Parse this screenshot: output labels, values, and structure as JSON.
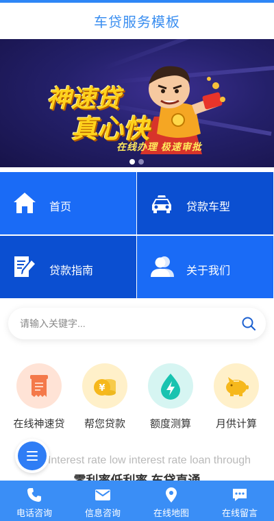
{
  "header": {
    "title": "车贷服务模板"
  },
  "banner": {
    "headline1": "神速贷",
    "headline2": "真心快",
    "slogan": "在线办理  极速审批",
    "active_slide": 1,
    "slide_count": 2
  },
  "nav": [
    {
      "label": "首页",
      "icon": "home-icon"
    },
    {
      "label": "贷款车型",
      "icon": "car-icon"
    },
    {
      "label": "贷款指南",
      "icon": "edit-document-icon"
    },
    {
      "label": "关于我们",
      "icon": "people-icon"
    }
  ],
  "search": {
    "placeholder": "请输入关键字...",
    "icon": "search-icon"
  },
  "features": [
    {
      "label": "在线神速贷",
      "icon": "receipt-icon",
      "bg": "#ffe3d6",
      "color": "#f4794a"
    },
    {
      "label": "帮您贷款",
      "icon": "coins-icon",
      "bg": "#fff0c9",
      "color": "#f6b81c"
    },
    {
      "label": "额度测算",
      "icon": "lightning-drop-icon",
      "bg": "#d6f5f2",
      "color": "#19c3b0"
    },
    {
      "label": "月供计算",
      "icon": "piggy-bank-icon",
      "bg": "#fff0c9",
      "color": "#f6b81c"
    }
  ],
  "intro": {
    "en": "Interest rate low interest rate loan through",
    "cn": "零利率低利率  车贷直通"
  },
  "bottom_nav": [
    {
      "label": "电话咨询",
      "icon": "phone-icon"
    },
    {
      "label": "信息咨询",
      "icon": "mail-icon"
    },
    {
      "label": "在线地图",
      "icon": "map-pin-icon"
    },
    {
      "label": "在线留言",
      "icon": "message-icon"
    }
  ],
  "colors": {
    "accent": "#2e86f6",
    "tile_light": "#1a6bf6",
    "tile_dark": "#0b4fd1",
    "bottom_bar": "#3a8ef6"
  }
}
